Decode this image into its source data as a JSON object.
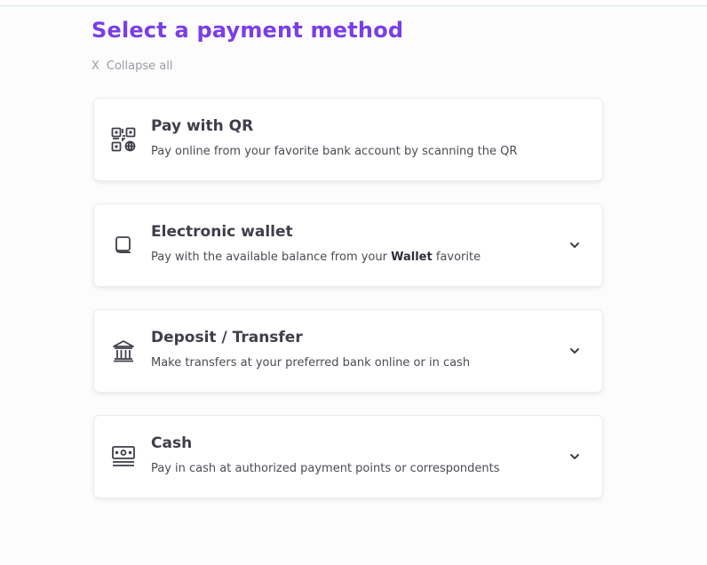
{
  "page": {
    "title": "Select a payment method",
    "collapse": {
      "icon": "X",
      "label": "Collapse all"
    }
  },
  "methods": [
    {
      "title": "Pay with QR",
      "description": "Pay online from your favorite bank account by scanning the QR",
      "icon": "qr-code-icon",
      "expandable": false
    },
    {
      "title": "Electronic wallet",
      "description_before": "Pay with the available balance from your ",
      "description_bold": "Wallet",
      "description_after": " favorite",
      "icon": "wallet-icon",
      "expandable": true
    },
    {
      "title": "Deposit / Transfer",
      "description": "Make transfers at your preferred bank online or in cash",
      "icon": "bank-icon",
      "expandable": true
    },
    {
      "title": "Cash",
      "description": "Pay in cash at authorized payment points or correspondents",
      "icon": "cash-icon",
      "expandable": true
    }
  ],
  "colors": {
    "accent": "#7a3ee8",
    "text": "#3f3f4b",
    "muted": "#9b9ba5"
  }
}
